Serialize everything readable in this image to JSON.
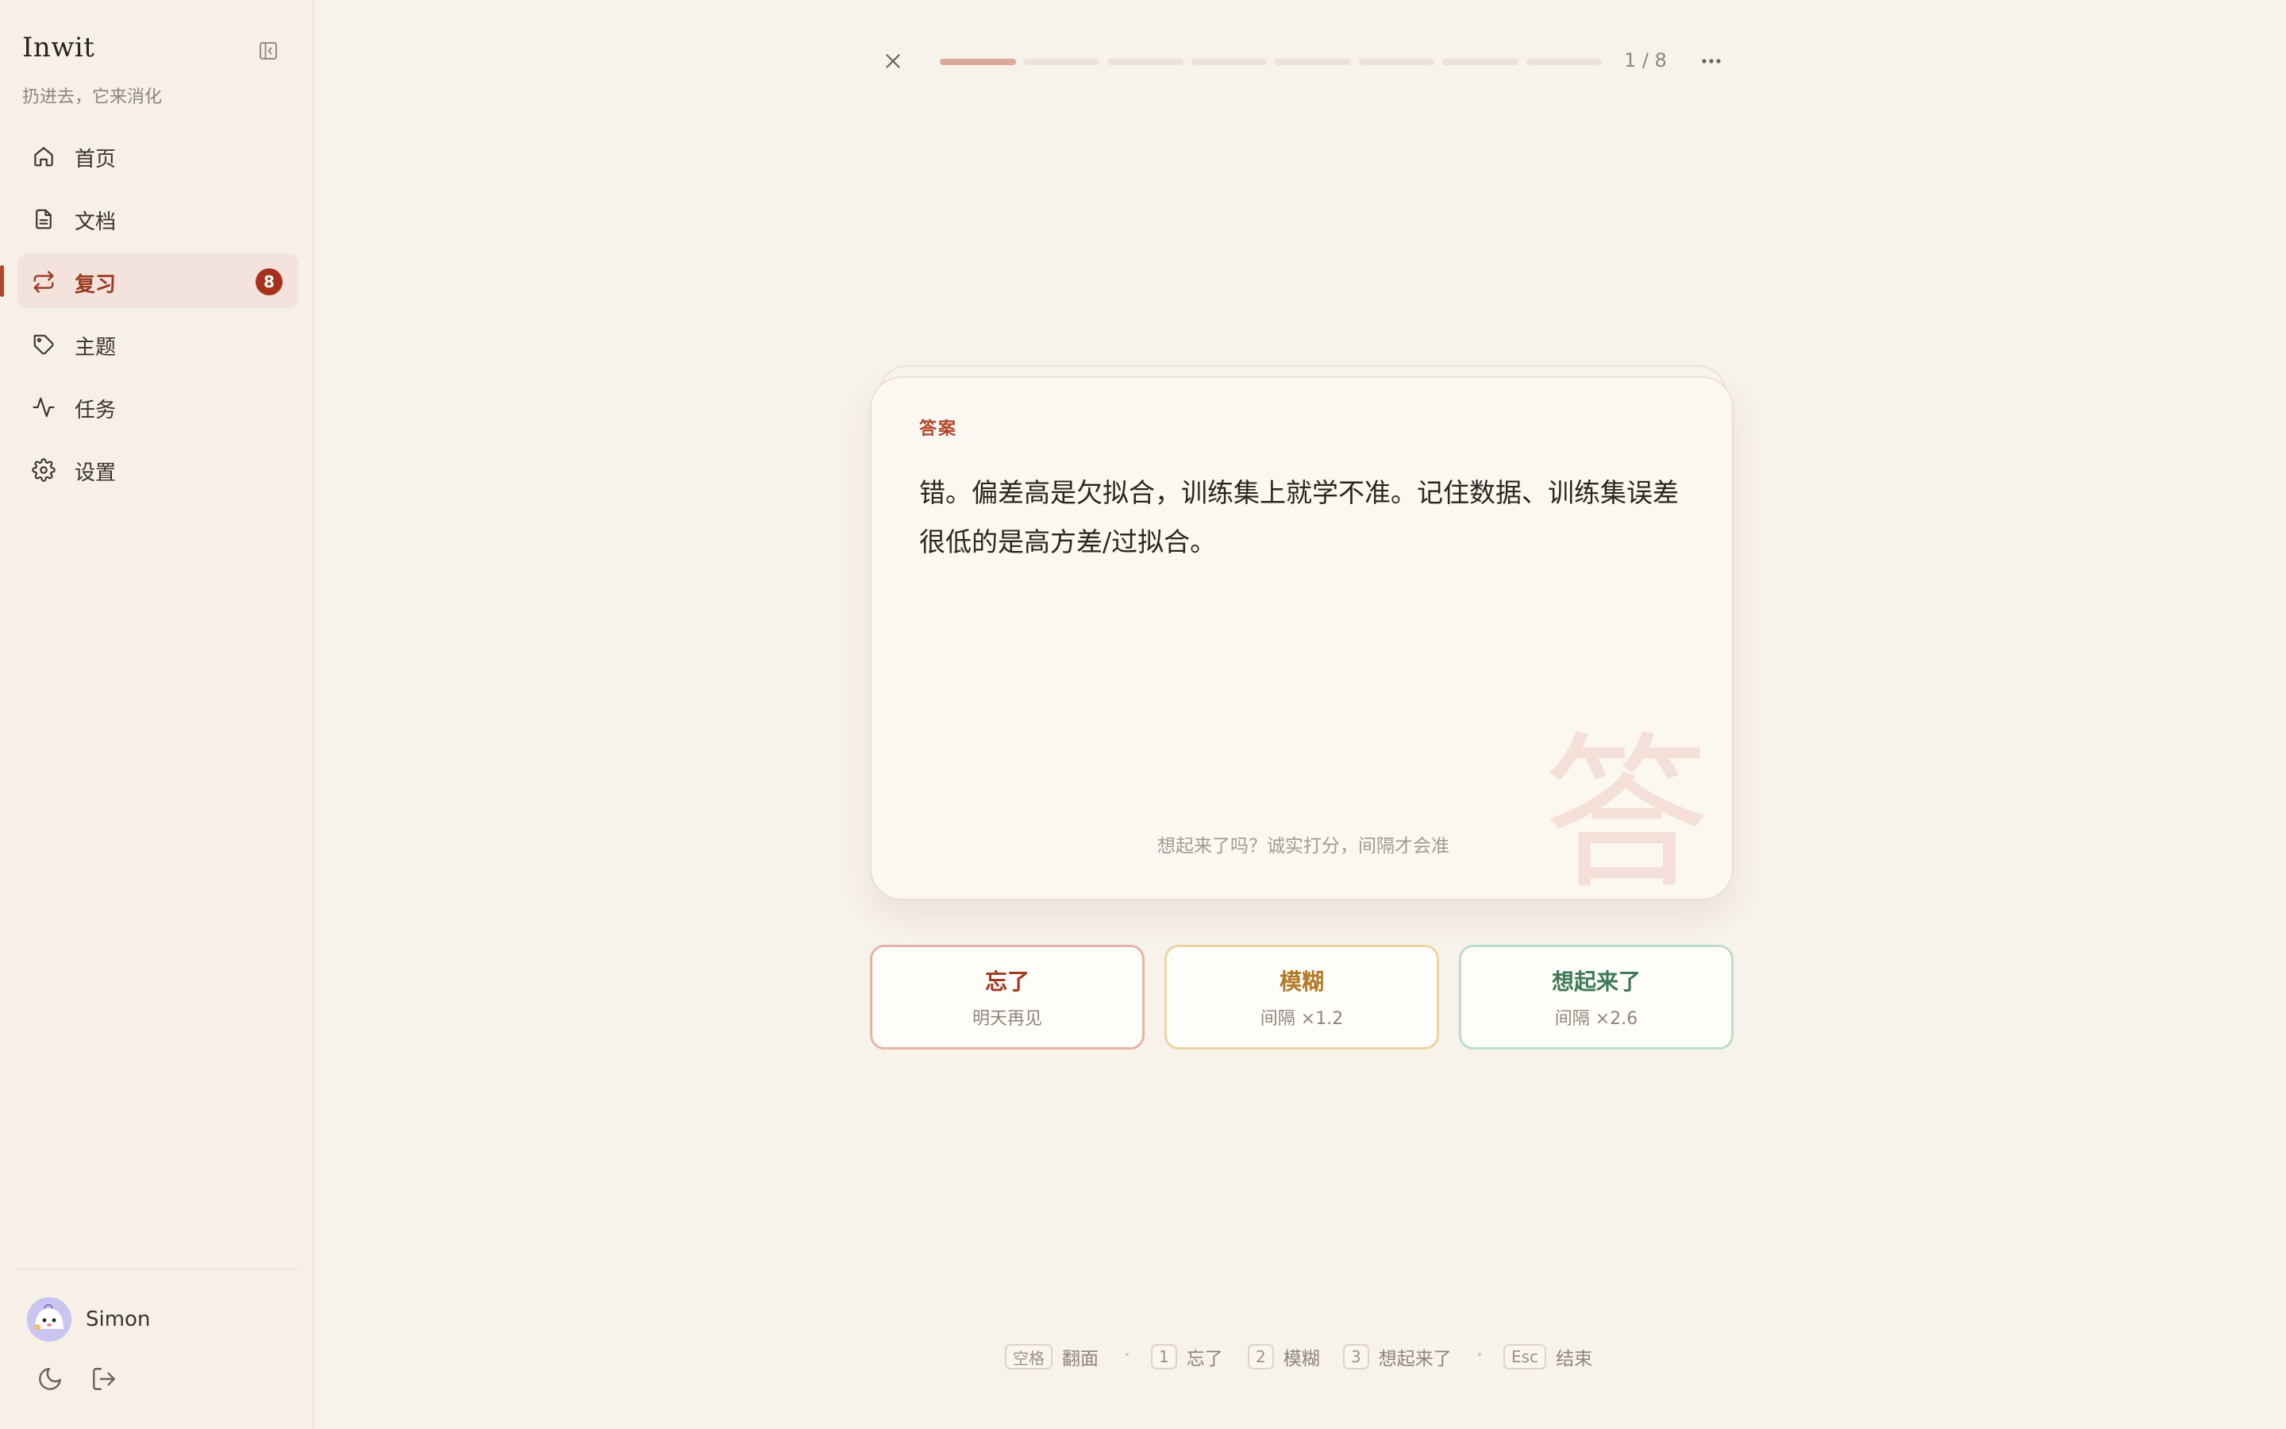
{
  "sidebar": {
    "brand": "Inwit",
    "tagline": "扔进去，它来消化",
    "items": [
      {
        "label": "首页",
        "icon": "home-icon"
      },
      {
        "label": "文档",
        "icon": "document-icon"
      },
      {
        "label": "复习",
        "icon": "review-repeat-icon",
        "badge": "8",
        "active": true
      },
      {
        "label": "主题",
        "icon": "tag-icon"
      },
      {
        "label": "任务",
        "icon": "activity-icon"
      },
      {
        "label": "设置",
        "icon": "settings-icon"
      }
    ],
    "user": {
      "name": "Simon"
    }
  },
  "session": {
    "counter": "1 / 8",
    "progress": {
      "current": 1,
      "total": 8
    }
  },
  "card": {
    "tag": "答案",
    "text": "错。偏差高是欠拟合，训练集上就学不准。记住数据、训练集误差很低的是高方差/过拟合。",
    "watermark": "答",
    "hint": "想起来了吗？诚实打分，间隔才会准"
  },
  "ratings": {
    "forgot": {
      "title": "忘了",
      "sub": "明天再见"
    },
    "fuzzy": {
      "title": "模糊",
      "sub": "间隔 ×1.2"
    },
    "recall": {
      "title": "想起来了",
      "sub": "间隔 ×2.6"
    }
  },
  "shortcuts": {
    "flip": {
      "key": "空格",
      "label": "翻面"
    },
    "forgot": {
      "key": "1",
      "label": "忘了"
    },
    "fuzzy": {
      "key": "2",
      "label": "模糊"
    },
    "recall": {
      "key": "3",
      "label": "想起来了"
    },
    "end": {
      "key": "Esc",
      "label": "结束"
    }
  },
  "colors": {
    "accent": "#a6321b",
    "background": "#f7f2ea",
    "progress_done": "#dba89a",
    "forgot": "#a03a22",
    "fuzzy": "#b07a28",
    "recall": "#3d7a56"
  }
}
